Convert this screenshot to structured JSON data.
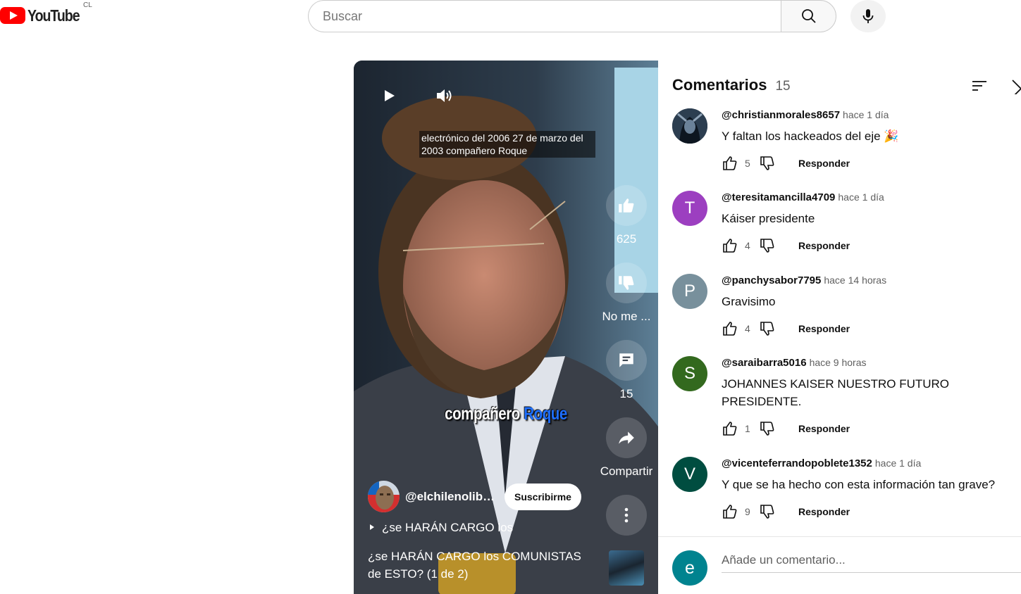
{
  "header": {
    "logo_text": "YouTube",
    "country_code": "CL",
    "search_placeholder": "Buscar"
  },
  "player": {
    "caption_top": "electrónico del 2006 27 de marzo del 2003 compañero Roque",
    "caption_mid_a": "compañero",
    "caption_mid_b": "Roque",
    "actions": {
      "like_count": "625",
      "dislike_label": "No me ...",
      "comment_count": "15",
      "share_label": "Compartir"
    },
    "channel_name": "@elchilenolibe...",
    "subscribe_label": "Suscribirme",
    "description": "¿se HARÁN CARGO los",
    "title": "¿se HARÁN CARGO los COMUNISTAS de ESTO? (1 de 2)"
  },
  "comments_panel": {
    "title": "Comentarios",
    "count": "15",
    "reply_label": "Responder",
    "add_placeholder": "Añade un comentario...",
    "add_avatar_letter": "e",
    "items": [
      {
        "user": "@christianmorales8657",
        "time": "hace 1 día",
        "text": "Y faltan los hackeados del eje 🎉",
        "likes": "5",
        "avatar_letter": "",
        "avatar_color": "#1b2a3a"
      },
      {
        "user": "@teresitamancilla4709",
        "time": "hace 1 día",
        "text": "Káiser presidente",
        "likes": "4",
        "avatar_letter": "T",
        "avatar_color": "#9c3fc0"
      },
      {
        "user": "@panchysabor7795",
        "time": "hace 14 horas",
        "text": "Gravisimo",
        "likes": "4",
        "avatar_letter": "P",
        "avatar_color": "#78909c"
      },
      {
        "user": "@saraibarra5016",
        "time": "hace 9 horas",
        "text": "JOHANNES KAISER NUESTRO FUTURO PRESIDENTE.",
        "likes": "1",
        "avatar_letter": "S",
        "avatar_color": "#33691e"
      },
      {
        "user": "@vicenteferrandopoblete1352",
        "time": "hace 1 día",
        "text": "Y que se ha hecho con esta información tan grave?",
        "likes": "9",
        "avatar_letter": "V",
        "avatar_color": "#004d40"
      }
    ]
  }
}
